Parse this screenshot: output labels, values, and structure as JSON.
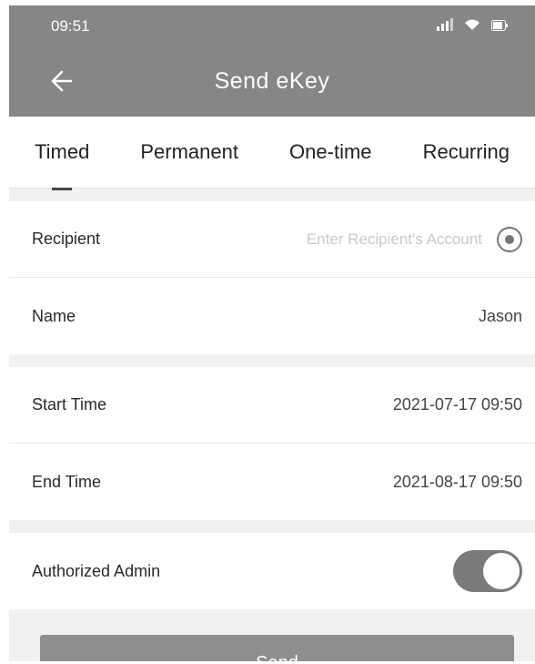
{
  "status_bar": {
    "time": "09:51",
    "icons": [
      "signal-icon",
      "wifi-icon",
      "battery-icon"
    ]
  },
  "header": {
    "title": "Send eKey",
    "back_icon": "back-arrow-icon"
  },
  "tabs": [
    {
      "label": "Timed",
      "active": true
    },
    {
      "label": "Permanent",
      "active": false
    },
    {
      "label": "One-time",
      "active": false
    },
    {
      "label": "Recurring",
      "active": false
    }
  ],
  "form": {
    "recipient": {
      "label": "Recipient",
      "placeholder": "Enter Recipient's Account",
      "value": ""
    },
    "name": {
      "label": "Name",
      "value": "Jason"
    },
    "start_time": {
      "label": "Start Time",
      "value": "2021-07-17 09:50"
    },
    "end_time": {
      "label": "End Time",
      "value": "2021-08-17 09:50"
    },
    "authorized_admin": {
      "label": "Authorized Admin",
      "enabled": true
    }
  },
  "actions": {
    "send_label": "Send"
  },
  "colors": {
    "header_bg": "#868686",
    "button_bg": "#8e8e8e",
    "toggle_on": "#7a7a7a",
    "page_bg": "#f1f1f1"
  }
}
